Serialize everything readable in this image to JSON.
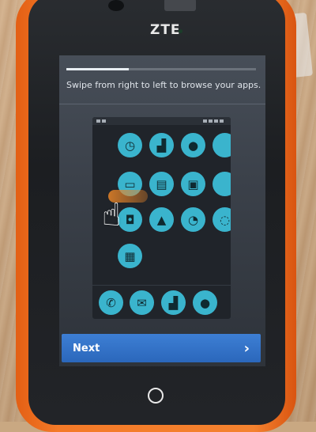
{
  "device": {
    "brand": "ZTE",
    "case_color": "#f07a26"
  },
  "onboarding": {
    "progress": 0.33,
    "instruction": "Swipe from right to left to browse your apps."
  },
  "illustration": {
    "app_grid": [
      {
        "icon": "clock-icon",
        "glyph": "◷"
      },
      {
        "icon": "signal-bars-icon",
        "glyph": "▟"
      },
      {
        "icon": "contact-icon",
        "glyph": "●"
      },
      {
        "icon": "partial-app-icon",
        "glyph": ""
      },
      {
        "icon": "messages-icon",
        "glyph": "▭"
      },
      {
        "icon": "radio-icon",
        "glyph": "▤"
      },
      {
        "icon": "video-icon",
        "glyph": "▣"
      },
      {
        "icon": "partial-app-icon",
        "glyph": ""
      },
      {
        "icon": "app-icon",
        "glyph": "◘"
      },
      {
        "icon": "fire-icon",
        "glyph": "▲"
      },
      {
        "icon": "clock-icon",
        "glyph": "◔"
      },
      {
        "icon": "partial-app-icon",
        "glyph": "◌"
      },
      {
        "icon": "calculator-icon",
        "glyph": "▦"
      }
    ],
    "dock": [
      {
        "icon": "phone-icon",
        "glyph": "✆"
      },
      {
        "icon": "mail-icon",
        "glyph": "✉"
      },
      {
        "icon": "signal-bars-icon",
        "glyph": "▟"
      },
      {
        "icon": "chat-icon",
        "glyph": "●"
      }
    ],
    "accent_color": "#3ab4cd",
    "swipe_color": "#e98528"
  },
  "footer": {
    "next_label": "Next",
    "next_chevron": "›",
    "accent_color": "#2f6fc8"
  }
}
